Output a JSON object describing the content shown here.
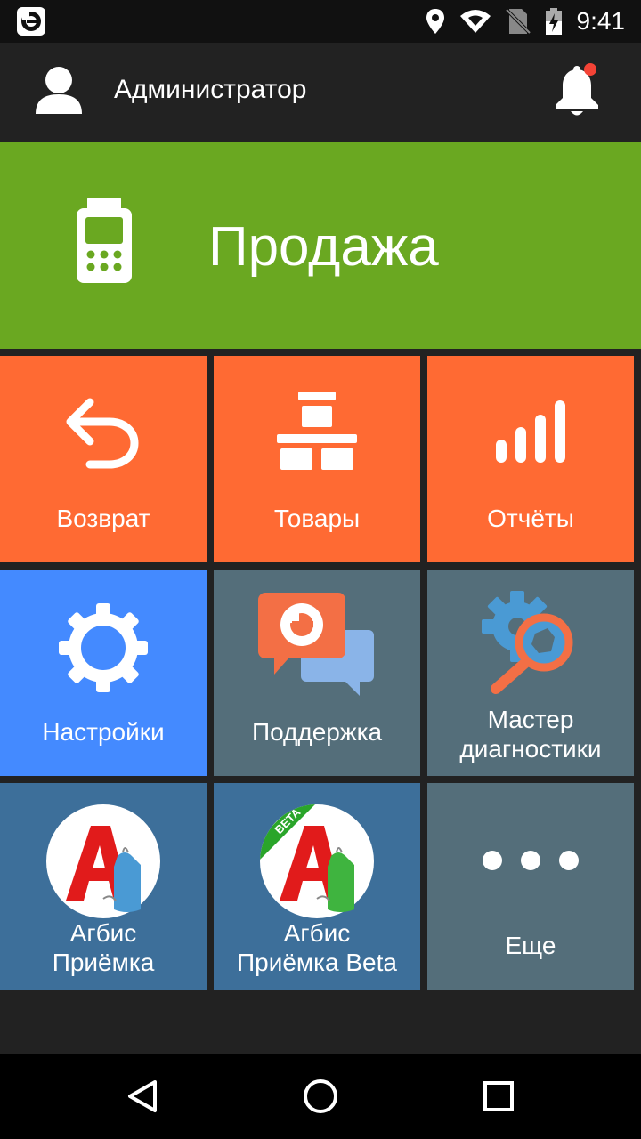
{
  "status_bar": {
    "time": "9:41",
    "app_icon": "evotor-logo-icon",
    "icons": [
      "location-icon",
      "wifi-icon",
      "no-sim-icon",
      "battery-charging-icon"
    ]
  },
  "header": {
    "user_name": "Администратор",
    "user_icon": "user-avatar-icon",
    "notification_icon": "bell-icon",
    "notification_dot_color": "#f44336"
  },
  "sale": {
    "label": "Продажа",
    "icon": "pos-terminal-icon",
    "color": "#6aa821"
  },
  "tiles": [
    {
      "label": "Возврат",
      "icon": "return-arrow-icon",
      "color": "#ff6a33"
    },
    {
      "label": "Товары",
      "icon": "boxes-icon",
      "color": "#ff6a33"
    },
    {
      "label": "Отчёты",
      "icon": "signal-bars-icon",
      "color": "#ff6a33"
    },
    {
      "label": "Настройки",
      "icon": "gear-icon",
      "color": "#448aff"
    },
    {
      "label": "Поддержка",
      "icon": "chat-bubbles-icon",
      "color": "#546e7a"
    },
    {
      "label_line1": "Мастер",
      "label_line2": "диагностики",
      "icon": "diagnostics-magnifier-icon",
      "color": "#546e7a"
    },
    {
      "label_line1": "Агбис",
      "label_line2": "Приёмка",
      "icon": "agbis-logo-icon",
      "color": "#3d6f9a"
    },
    {
      "label_line1": "Агбис",
      "label_line2": "Приёмка Beta",
      "badge": "BETA",
      "icon": "agbis-beta-logo-icon",
      "color": "#3d6f9a"
    },
    {
      "label": "Еще",
      "icon": "more-dots-icon",
      "color": "#546e7a"
    }
  ],
  "nav_bar": {
    "icons": [
      "back-icon",
      "home-icon",
      "recents-icon"
    ]
  }
}
